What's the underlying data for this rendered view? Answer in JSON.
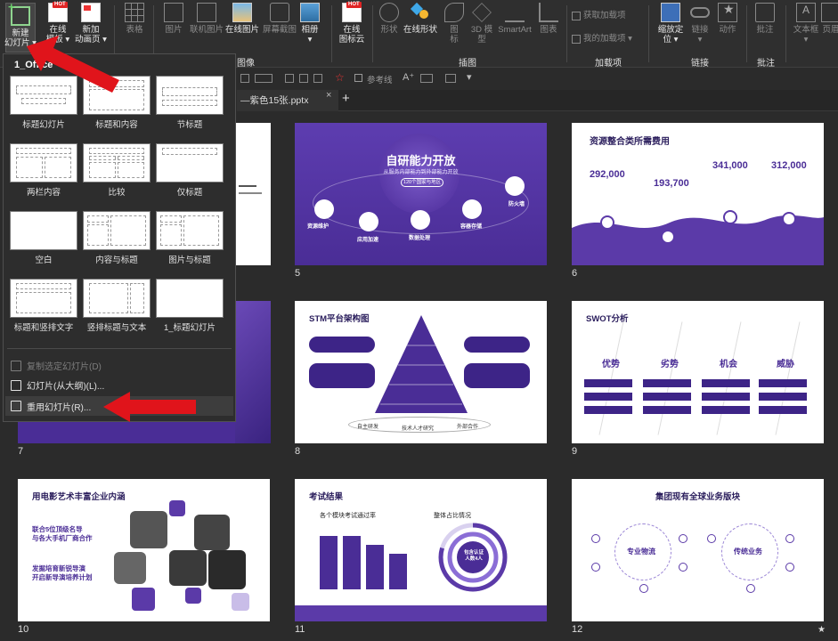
{
  "ribbon": {
    "buttons": [
      {
        "label": "新建\n幻灯片 ▾",
        "icon": "new-slide-icon"
      },
      {
        "label": "在线\n模板 ▾",
        "icon": "online-template-icon",
        "badge": "HOT"
      },
      {
        "label": "新加\n动画页 ▾",
        "icon": "animation-page-icon"
      },
      {
        "label": "表格",
        "icon": "table-icon"
      },
      {
        "label": "图片",
        "icon": "picture-icon"
      },
      {
        "label": "联机图片",
        "icon": "online-picture-icon"
      },
      {
        "label": "在线图片",
        "icon": "web-picture-icon"
      },
      {
        "label": "屏幕截图",
        "icon": "screenshot-icon"
      },
      {
        "label": "相册\n▾",
        "icon": "album-icon"
      },
      {
        "label": "在线\n图标云",
        "icon": "icon-cloud-icon",
        "badge": "HOT"
      },
      {
        "label": "形状",
        "icon": "shapes-icon"
      },
      {
        "label": "在线形状",
        "icon": "online-shapes-icon"
      },
      {
        "label": "图\n标",
        "icon": "icons-icon"
      },
      {
        "label": "3D 模\n型",
        "icon": "3d-model-icon"
      },
      {
        "label": "SmartArt",
        "icon": "smartart-icon"
      },
      {
        "label": "图表",
        "icon": "chart-icon"
      },
      {
        "label": "获取加载项",
        "icon": "get-addins-icon"
      },
      {
        "label": "我的加载项 ▾",
        "icon": "my-addins-icon"
      },
      {
        "label": "缩放定\n位 ▾",
        "icon": "zoom-icon"
      },
      {
        "label": "链接\n▾",
        "icon": "link-icon"
      },
      {
        "label": "动作",
        "icon": "action-icon"
      },
      {
        "label": "批注",
        "icon": "comment-icon"
      },
      {
        "label": "文本框\n▾",
        "icon": "textbox-icon"
      },
      {
        "label": "页眉",
        "icon": "header-icon"
      }
    ],
    "groups": [
      "图像",
      "插图",
      "加载项",
      "链接",
      "批注"
    ]
  },
  "toolbar2": {
    "items": [
      "参考线"
    ]
  },
  "tab": {
    "title": "—紫色15张.pptx",
    "close": "×",
    "plus": "+"
  },
  "dropdown": {
    "theme_title": "1_Office",
    "layouts": [
      "标题幻灯片",
      "标题和内容",
      "节标题",
      "两栏内容",
      "比较",
      "仅标题",
      "空白",
      "内容与标题",
      "图片与标题",
      "标题和竖排文字",
      "竖排标题与文本",
      "1_标题幻灯片"
    ],
    "menu": [
      {
        "label": "复制选定幻灯片(D)",
        "disabled": true
      },
      {
        "label": "幻灯片(从大纲)(L)...",
        "disabled": false
      },
      {
        "label": "重用幻灯片(R)...",
        "disabled": false
      }
    ]
  },
  "slides": {
    "numbers": [
      "5",
      "6",
      "7",
      "8",
      "9",
      "10",
      "11",
      "12"
    ],
    "s5": {
      "title": "自研能力开放",
      "subtitle": "从服务内部能力到外部能力开放",
      "badge": "120个国家与地区",
      "nodes": [
        "资源维护",
        "应用加速",
        "数据处理",
        "容器存储",
        "防火墙"
      ]
    },
    "s6": {
      "title": "资源整合类所需费用",
      "values": [
        "292,000",
        "193,700",
        "341,000",
        "312,000"
      ]
    },
    "s8": {
      "title": "STM平台架构图",
      "bottom": [
        "自主研发",
        "技术人才研究",
        "外部合作"
      ]
    },
    "s9": {
      "title": "SWOT分析",
      "columns": [
        "优势",
        "劣势",
        "机会",
        "威胁"
      ]
    },
    "s10": {
      "title": "用电影艺术丰富企业内涵",
      "p1": "联合5位顶级名导\n与各大手机厂商合作",
      "p2": "发掘培育新锐导演\n开启新导演培养计划"
    },
    "s11": {
      "title": "考试结果",
      "left": "各个模块考试通过率",
      "right": "整体占比情况",
      "center": "包含认证\n人数4人"
    },
    "s12": {
      "title": "集团现有全球业务版块",
      "hubs": [
        "专业物流",
        "传统业务"
      ]
    }
  },
  "colors": {
    "accent": "#5b3aa8",
    "arrow": "#e0141b",
    "dark": "#2f2f2f"
  }
}
